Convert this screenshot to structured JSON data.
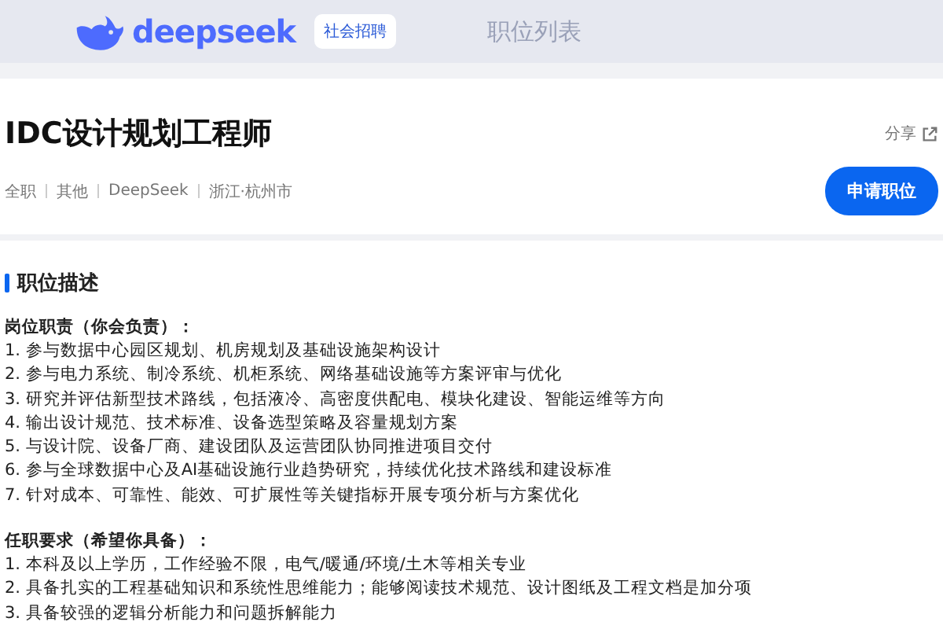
{
  "header": {
    "logo": "deepseek",
    "badge": "社会招聘",
    "nav": "职位列表"
  },
  "job": {
    "title": "IDC设计规划工程师",
    "share": "分享",
    "meta": [
      "全职",
      "其他",
      "DeepSeek",
      "浙江·杭州市"
    ],
    "apply": "申请职位"
  },
  "section": {
    "title": "职位描述",
    "blocks": [
      {
        "heading": "岗位职责（你会负责）：",
        "lines": [
          "1. 参与数据中心园区规划、机房规划及基础设施架构设计",
          "2. 参与电力系统、制冷系统、机柜系统、网络基础设施等方案评审与优化",
          "3. 研究并评估新型技术路线，包括液冷、高密度供配电、模块化建设、智能运维等方向",
          "4. 输出设计规范、技术标准、设备选型策略及容量规划方案",
          "5. 与设计院、设备厂商、建设团队及运营团队协同推进项目交付",
          "6. 参与全球数据中心及AI基础设施行业趋势研究，持续优化技术路线和建设标准",
          "7. 针对成本、可靠性、能效、可扩展性等关键指标开展专项分析与方案优化"
        ]
      },
      {
        "heading": "任职要求（希望你具备）：",
        "lines": [
          "1. 本科及以上学历，工作经验不限，电气/暖通/环境/土木等相关专业",
          "2. 具备扎实的工程基础知识和系统性思维能力；能够阅读技术规范、设计图纸及工程文档是加分项",
          "3. 具备较强的逻辑分析能力和问题拆解能力"
        ]
      }
    ]
  }
}
